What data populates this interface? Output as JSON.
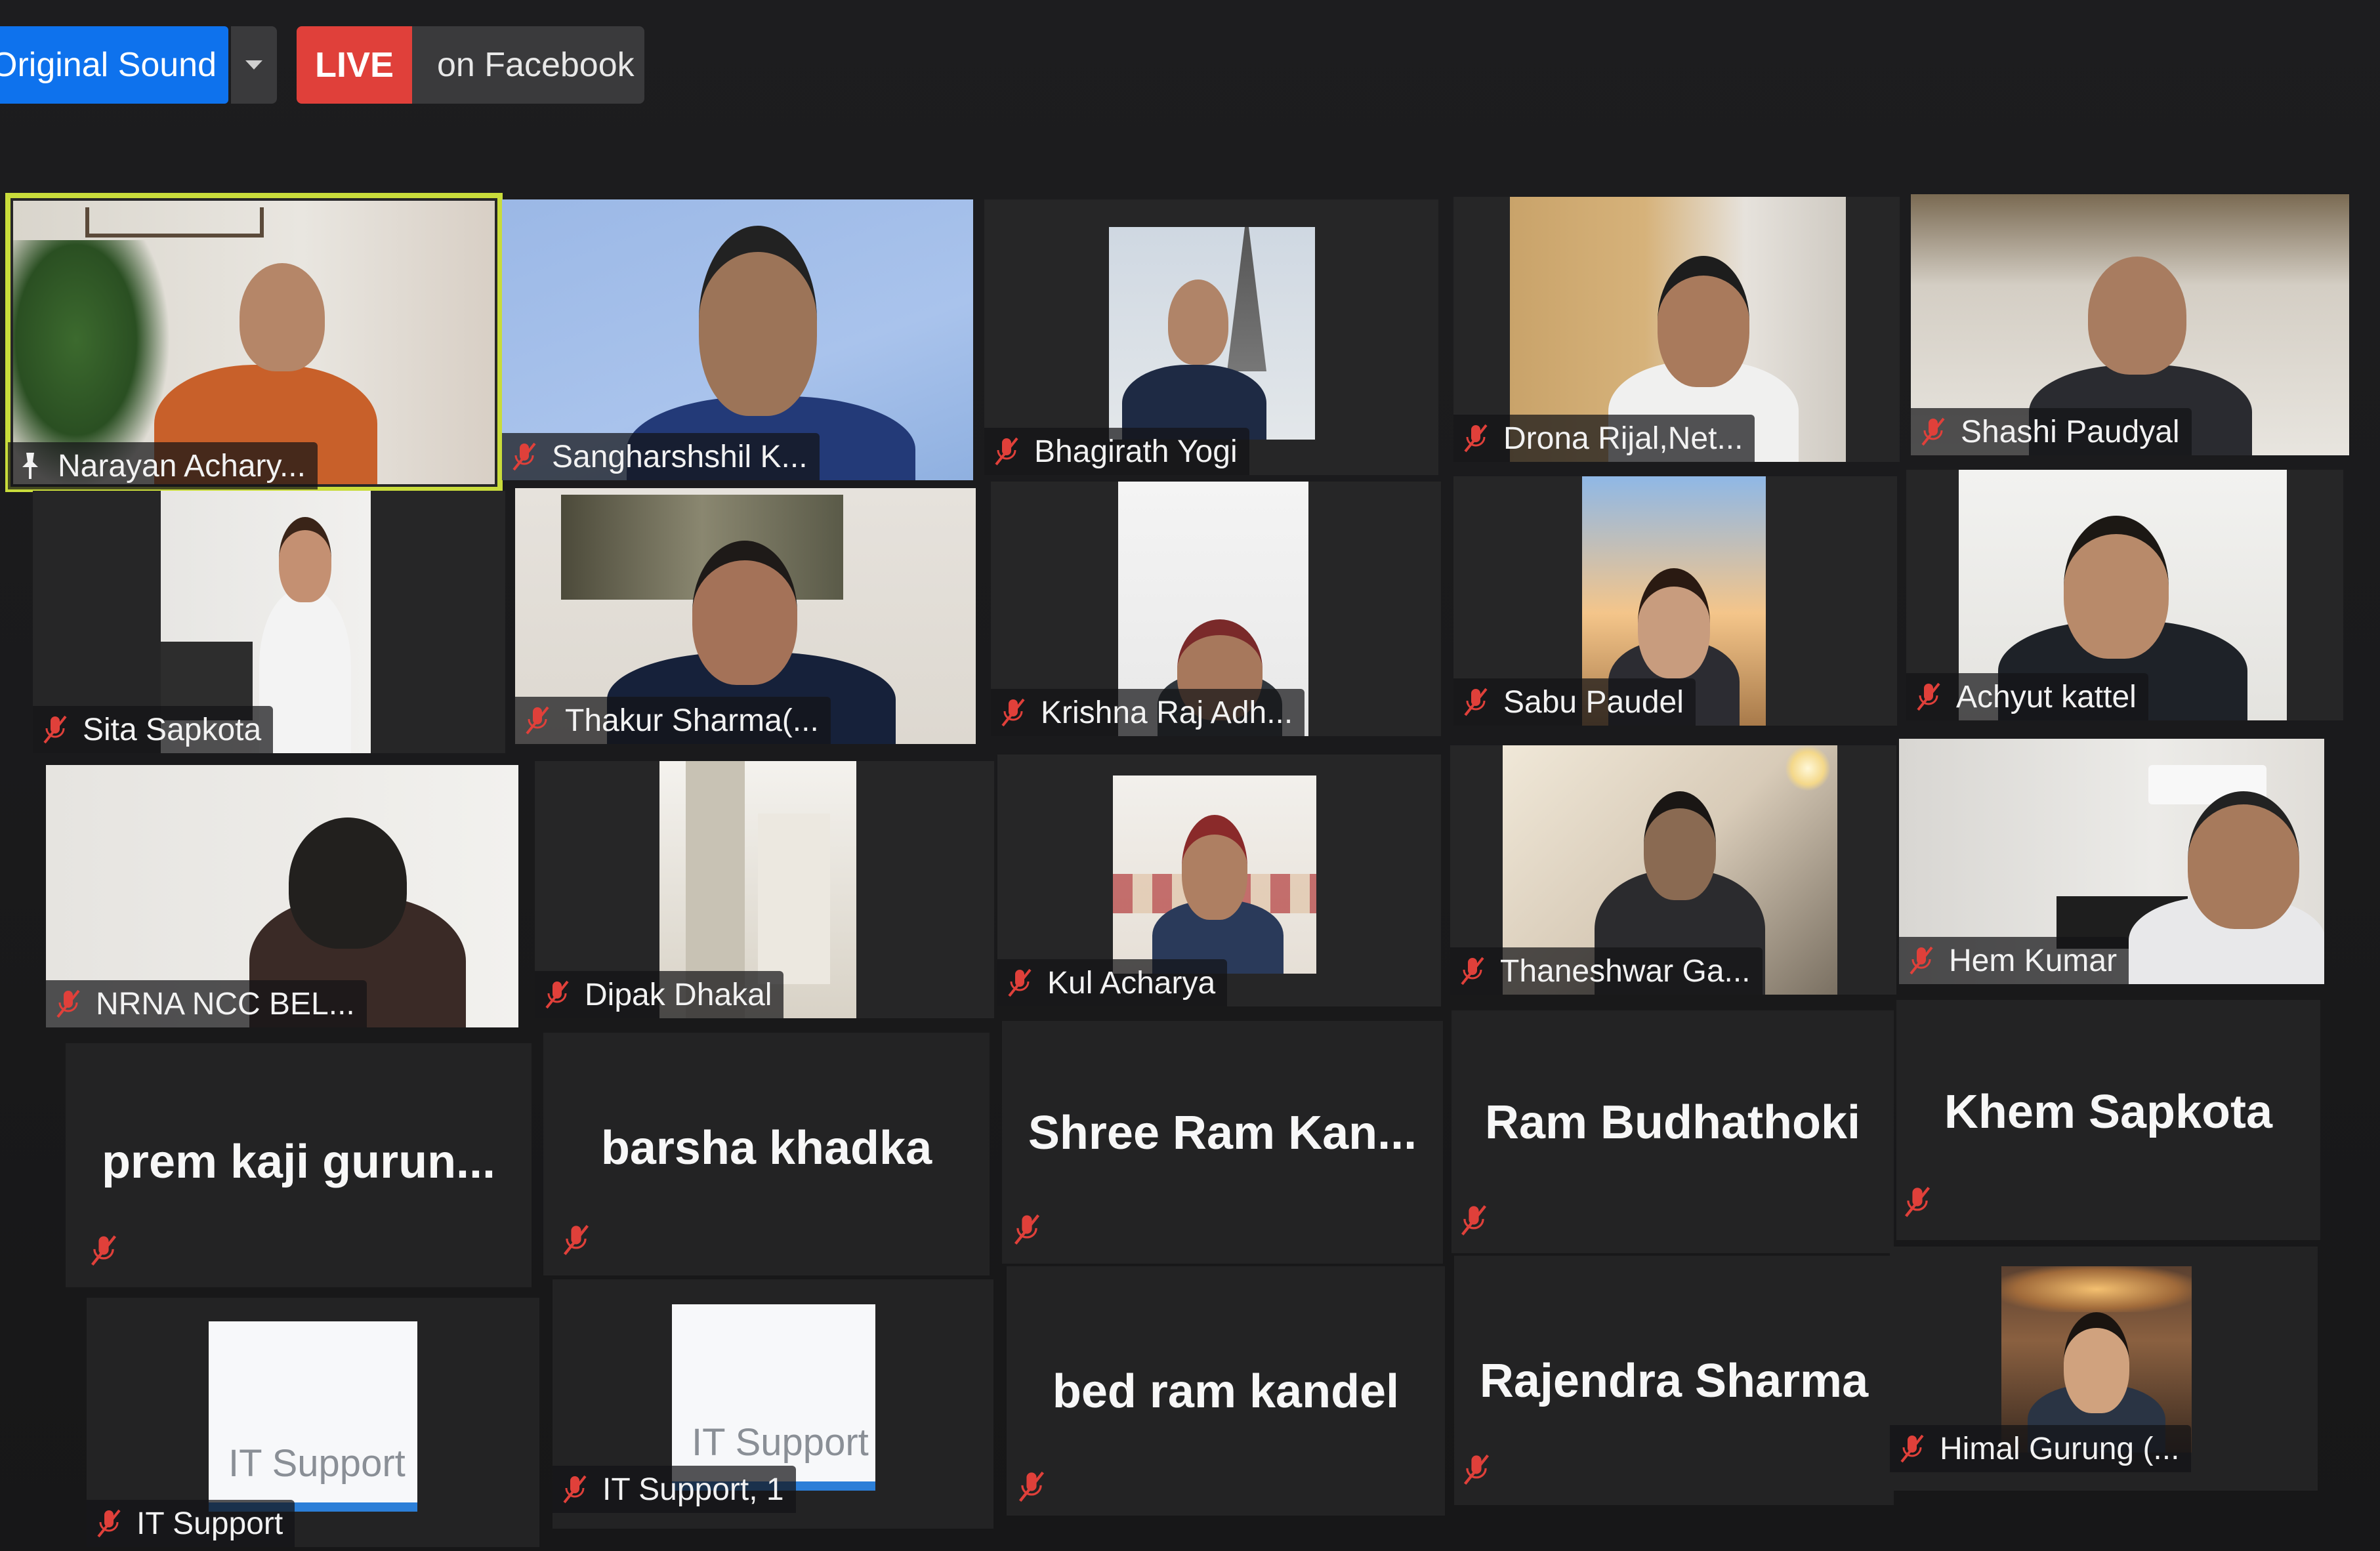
{
  "toolbar": {
    "original_sound_label": "Original Sound",
    "live_badge": "LIVE",
    "live_text": "on Facebook"
  },
  "colors": {
    "accent_blue": "#0e72ed",
    "live_red": "#e0403a",
    "active_speaker": "#c9dc3b",
    "muted_red": "#e0403a"
  },
  "participants": {
    "p01": "Narayan Achary...",
    "p02": "Sangharshshil K...",
    "p03": "Bhagirath Yogi",
    "p04": "Drona Rijal,Net...",
    "p05": "Shashi Paudyal",
    "p06": "Sita Sapkota",
    "p07": "Thakur Sharma(...",
    "p08": "Krishna Raj Adh...",
    "p09": "Sabu Paudel",
    "p10": "Achyut kattel",
    "p11": "NRNA NCC BEL...",
    "p12": "Dipak Dhakal",
    "p13": "Kul Acharya",
    "p14": "Thaneshwar Ga...",
    "p15": "Hem Kumar",
    "p16": "prem kaji gurun...",
    "p17": "barsha khadka",
    "p18": "Shree Ram Kan...",
    "p19": "Ram Budhathoki",
    "p20": "Khem Sapkota",
    "p21": "IT Support",
    "p22": "IT Support, 1",
    "p23": "bed ram kandel",
    "p24": "Rajendra Sharma",
    "p25": "Himal Gurung (..."
  },
  "it_card_text": "IT Support",
  "icons": {
    "muted": "microphone-muted-icon",
    "pinned": "pin-icon",
    "caret": "chevron-down-icon"
  }
}
